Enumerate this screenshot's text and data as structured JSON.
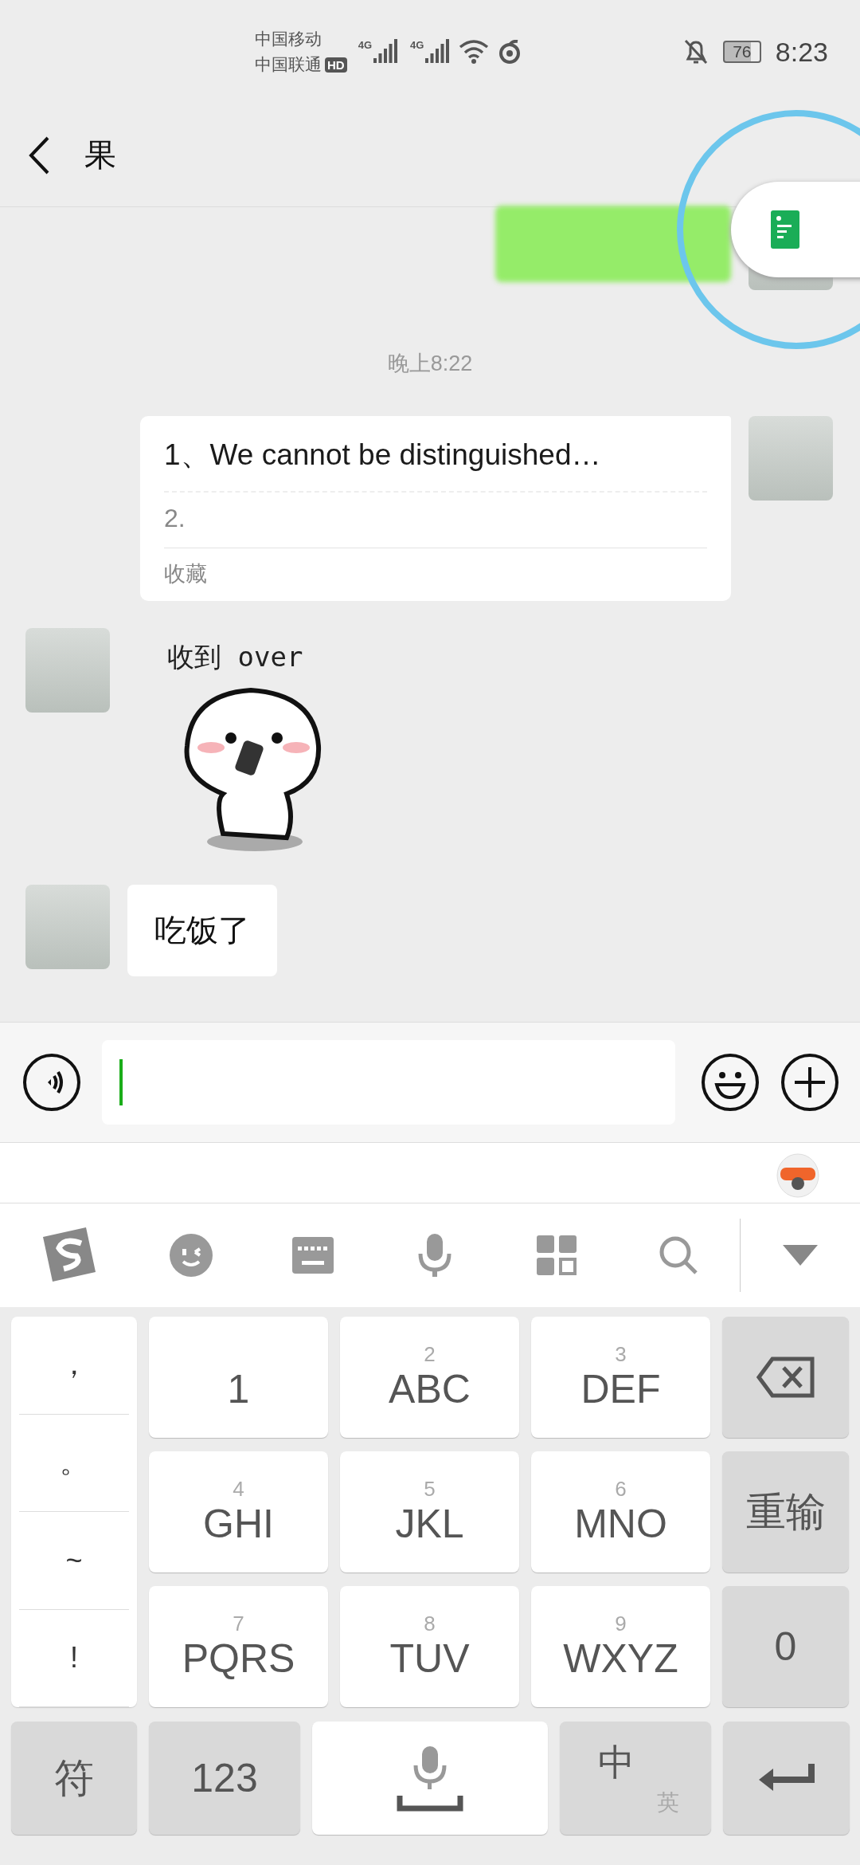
{
  "status_bar": {
    "carriers": [
      "中国移动",
      "中国联通"
    ],
    "hd_badge": "HD",
    "signals": [
      "4G",
      "4G"
    ],
    "battery": "76",
    "time": "8:23"
  },
  "header": {
    "title": "果"
  },
  "messages": [
    {
      "kind": "blurred",
      "outgoing": true
    },
    {
      "kind": "time",
      "text": "晚上8:22"
    },
    {
      "kind": "note",
      "outgoing": true,
      "title": "1、We cannot be distinguished…",
      "line": "2.",
      "source": "收藏"
    },
    {
      "kind": "sticker",
      "outgoing": false,
      "caption": "收到 over"
    },
    {
      "kind": "text",
      "outgoing": false,
      "text": "吃饭了"
    }
  ],
  "keyboard": {
    "punctuation": [
      "，",
      "。",
      "~",
      "!"
    ],
    "key_rows": [
      [
        {
          "kind": "key",
          "label": "1"
        },
        {
          "kind": "key",
          "digit": "2",
          "label": "ABC"
        },
        {
          "kind": "key",
          "digit": "3",
          "label": "DEF"
        },
        {
          "kind": "delete"
        }
      ],
      [
        {
          "kind": "key",
          "digit": "4",
          "label": "GHI"
        },
        {
          "kind": "key",
          "digit": "5",
          "label": "JKL"
        },
        {
          "kind": "key",
          "digit": "6",
          "label": "MNO"
        },
        {
          "kind": "text",
          "label": "重输"
        }
      ],
      [
        {
          "kind": "key",
          "digit": "7",
          "label": "PQRS"
        },
        {
          "kind": "key",
          "digit": "8",
          "label": "TUV"
        },
        {
          "kind": "key",
          "digit": "9",
          "label": "WXYZ"
        },
        {
          "kind": "text",
          "label": "0"
        }
      ]
    ],
    "bottom_keys": [
      {
        "kind": "text",
        "label": "符"
      },
      {
        "kind": "text",
        "label": "123"
      },
      {
        "kind": "space"
      },
      {
        "kind": "lang",
        "main": "中",
        "sub": "英"
      },
      {
        "kind": "enter"
      }
    ]
  }
}
